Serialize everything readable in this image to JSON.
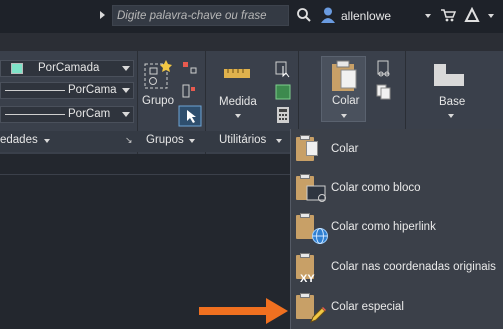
{
  "titlebar": {
    "search_placeholder": "Digite palavra-chave ou frase",
    "user_name": "allenlowe"
  },
  "ribbon": {
    "layer_combo": "PorCamada",
    "linetype_combo": "PorCama",
    "lineweight_combo": "PorCam",
    "panel_props_label": "edades",
    "panel_groups_label": "Grupos",
    "panel_utils_label": "Utilitários",
    "group_button_label": "Grupo",
    "measure_button_label": "Medida",
    "paste_button_label": "Colar",
    "base_button_label": "Base",
    "layer_color": "#7fe3c8"
  },
  "paste_menu": {
    "items": [
      {
        "label": "Colar",
        "icon": "paste-icon"
      },
      {
        "label": "Colar como bloco",
        "icon": "paste-block-icon"
      },
      {
        "label": "Colar como hiperlink",
        "icon": "paste-hyperlink-icon"
      },
      {
        "label": "Colar nas coordenadas originais",
        "icon": "paste-original-coords-icon"
      },
      {
        "label": "Colar especial",
        "icon": "paste-special-icon"
      }
    ]
  },
  "annotation": {
    "arrow_color": "#f07020",
    "arrow_target": "paste-special"
  }
}
